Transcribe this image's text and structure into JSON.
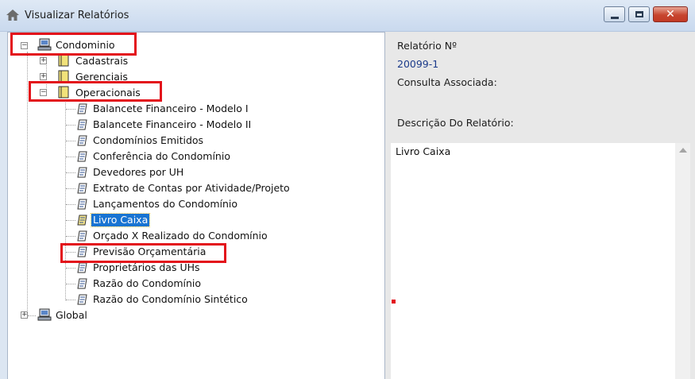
{
  "window": {
    "title": "Visualizar Relatórios",
    "close_glyph": "✕",
    "accent_close": "#c7452f"
  },
  "tree": {
    "root": {
      "label": "Condominio",
      "icon": "computer-icon",
      "expanded": true
    },
    "groups": [
      {
        "label": "Cadastrais",
        "icon": "folder-icon",
        "expanded": false
      },
      {
        "label": "Gerenciais",
        "icon": "folder-icon",
        "expanded": false
      },
      {
        "label": "Operacionais",
        "icon": "folder-icon",
        "expanded": true
      }
    ],
    "reports": [
      {
        "label": "Balancete Financeiro - Modelo I"
      },
      {
        "label": "Balancete Financeiro - Modelo II"
      },
      {
        "label": "Condomínios Emitidos"
      },
      {
        "label": "Conferência do Condomínio"
      },
      {
        "label": "Devedores por UH"
      },
      {
        "label": "Extrato de Contas por Atividade/Projeto"
      },
      {
        "label": "Lançamentos do Condomínio"
      },
      {
        "label": "Livro Caixa",
        "selected": true
      },
      {
        "label": "Orçado X Realizado do Condomínio"
      },
      {
        "label": "Previsão Orçamentária"
      },
      {
        "label": "Proprietários das UHs"
      },
      {
        "label": "Razão do Condomínio"
      },
      {
        "label": "Razão do Condomínio Sintético"
      }
    ],
    "global": {
      "label": "Global",
      "icon": "computer-icon",
      "expanded": false
    }
  },
  "details": {
    "report_number_label": "Relatório Nº",
    "report_number_value": "20099-1",
    "query_label": "Consulta Associada:",
    "description_label": "Descrição Do Relatório:",
    "description_text": "Livro Caixa"
  },
  "colors": {
    "highlight_box": "#e3121b",
    "selection": "#1874d2",
    "value_text": "#1c3b8a"
  }
}
